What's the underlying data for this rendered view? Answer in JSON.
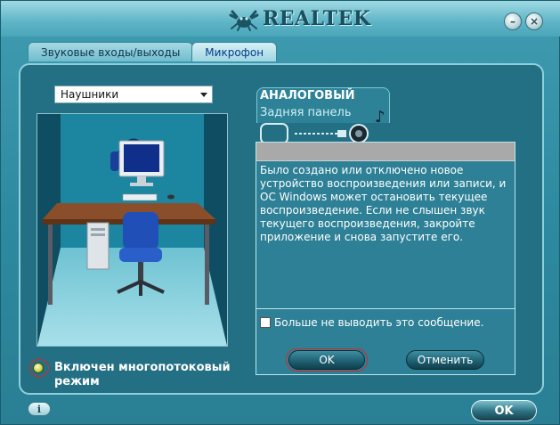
{
  "window": {
    "brand": "REALTEK",
    "minimize_symbol": "–",
    "close_symbol": "×"
  },
  "tabs": [
    {
      "label": "Звуковые входы/выходы",
      "active": false
    },
    {
      "label": "Микрофон",
      "active": true
    }
  ],
  "device_select": {
    "value": "Наушники"
  },
  "connector": {
    "title": "АНАЛОГОВЫЙ",
    "subtitle": "Задняя панель"
  },
  "dialog": {
    "message": "Было создано или отключено новое устройство воспроизведения или записи, и ОС Windows может остановить текущее воспроизведение. Если не слышен звук текущего воспроизведения, закройте приложение и снова запустите его.",
    "checkbox_label": "Больше не выводить это сообщение.",
    "checkbox_checked": false,
    "ok_label": "OK",
    "cancel_label": "Отменить"
  },
  "status": {
    "label": "Включен многопотоковый режим",
    "led_color": "#c7d94c"
  },
  "footer": {
    "info_label": "i",
    "ok_label": "OK"
  },
  "colors": {
    "accent_red": "#d42a2a",
    "panel_bg": "#236f84"
  },
  "icons": [
    "realtek-crab-logo",
    "headphones-icon",
    "computer-monitor-icon",
    "jack-plug-icon",
    "music-note-icon",
    "info-icon"
  ]
}
